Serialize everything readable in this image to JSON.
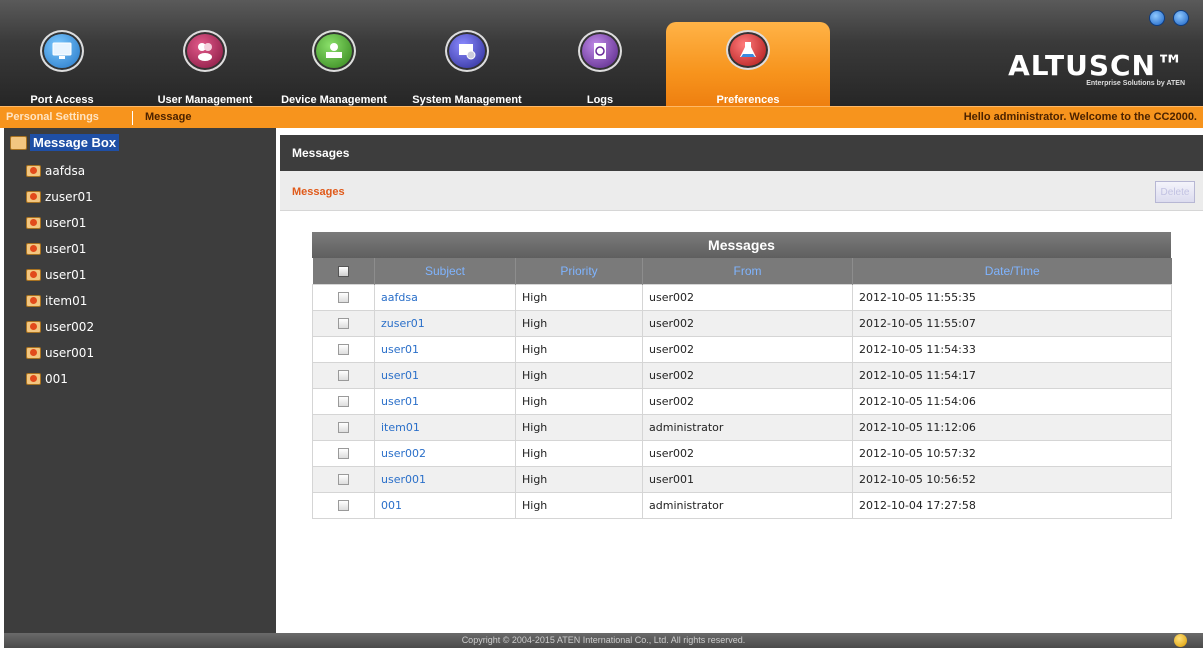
{
  "nav": {
    "tabs": [
      {
        "label": "Port Access",
        "icon": "monitor-icon",
        "color": "#2a8fd8"
      },
      {
        "label": "User Management",
        "icon": "users-icon",
        "color": "#9b1c4d"
      },
      {
        "label": "Device Management",
        "icon": "device-icon",
        "color": "#3a9a2a"
      },
      {
        "label": "System Management",
        "icon": "system-icon",
        "color": "#3a3ab8"
      },
      {
        "label": "Logs",
        "icon": "logs-icon",
        "color": "#6a2a9a"
      },
      {
        "label": "Preferences",
        "icon": "flask-icon",
        "color": "#d02020",
        "active": true
      }
    ]
  },
  "brand": {
    "name": "ALTUSCN™",
    "tagline": "Enterprise Solutions by ATEN"
  },
  "subbar": {
    "personal_settings": "Personal Settings",
    "message": "Message",
    "welcome": "Hello administrator. Welcome to the CC2000."
  },
  "sidebar": {
    "root": "Message Box",
    "items": [
      "aafdsa",
      "zuser01",
      "user01",
      "user01",
      "user01",
      "item01",
      "user002",
      "user001",
      "001"
    ]
  },
  "main": {
    "title": "Messages",
    "section_title": "Messages",
    "delete_label": "Delete"
  },
  "table": {
    "caption": "Messages",
    "headers": {
      "subject": "Subject",
      "priority": "Priority",
      "from": "From",
      "datetime": "Date/Time"
    },
    "rows": [
      {
        "subject": "aafdsa",
        "priority": "High",
        "from": "user002",
        "datetime": "2012-10-05 11:55:35"
      },
      {
        "subject": "zuser01",
        "priority": "High",
        "from": "user002",
        "datetime": "2012-10-05 11:55:07"
      },
      {
        "subject": "user01",
        "priority": "High",
        "from": "user002",
        "datetime": "2012-10-05 11:54:33"
      },
      {
        "subject": "user01",
        "priority": "High",
        "from": "user002",
        "datetime": "2012-10-05 11:54:17"
      },
      {
        "subject": "user01",
        "priority": "High",
        "from": "user002",
        "datetime": "2012-10-05 11:54:06"
      },
      {
        "subject": "item01",
        "priority": "High",
        "from": "administrator",
        "datetime": "2012-10-05 11:12:06"
      },
      {
        "subject": "user002",
        "priority": "High",
        "from": "user002",
        "datetime": "2012-10-05 10:57:32"
      },
      {
        "subject": "user001",
        "priority": "High",
        "from": "user001",
        "datetime": "2012-10-05 10:56:52"
      },
      {
        "subject": "001",
        "priority": "High",
        "from": "administrator",
        "datetime": "2012-10-04 17:27:58"
      }
    ]
  },
  "footer": {
    "copyright": "Copyright © 2004-2015 ATEN International Co., Ltd. All rights reserved."
  },
  "colors": {
    "accent": "#f7941d",
    "link": "#2a6fc9",
    "sidebar_bg": "#3d3d3d"
  }
}
